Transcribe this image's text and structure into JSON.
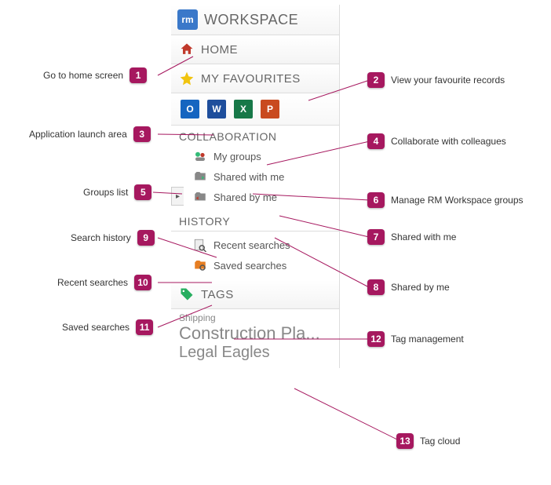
{
  "header": {
    "logo": "rm",
    "title": "WORKSPACE"
  },
  "nav": {
    "home": "HOME",
    "favourites": "MY FAVOURITES",
    "apps": [
      "O",
      "W",
      "X",
      "P"
    ]
  },
  "collab": {
    "header": "COLLABORATION",
    "items": [
      "My groups",
      "Shared with me",
      "Shared by me"
    ]
  },
  "history": {
    "header": "HISTORY",
    "items": [
      "Recent searches",
      "Saved searches"
    ]
  },
  "tags": {
    "header": "TAGS",
    "cloud": [
      "Shipping",
      "Construction Pla...",
      "Legal Eagles"
    ]
  },
  "callouts": {
    "c1": {
      "n": "1",
      "text": "Go to home screen"
    },
    "c2": {
      "n": "2",
      "text": "View your favourite records"
    },
    "c3": {
      "n": "3",
      "text": "Application launch area"
    },
    "c4": {
      "n": "4",
      "text": "Collaborate with colleagues"
    },
    "c5": {
      "n": "5",
      "text": "Groups list"
    },
    "c6": {
      "n": "6",
      "text": "Manage RM Workspace groups"
    },
    "c7": {
      "n": "7",
      "text": "Shared with me"
    },
    "c8": {
      "n": "8",
      "text": "Shared by me"
    },
    "c9": {
      "n": "9",
      "text": "Search history"
    },
    "c10": {
      "n": "10",
      "text": "Recent searches"
    },
    "c11": {
      "n": "11",
      "text": "Saved searches"
    },
    "c12": {
      "n": "12",
      "text": "Tag management"
    },
    "c13": {
      "n": "13",
      "text": "Tag cloud"
    }
  }
}
